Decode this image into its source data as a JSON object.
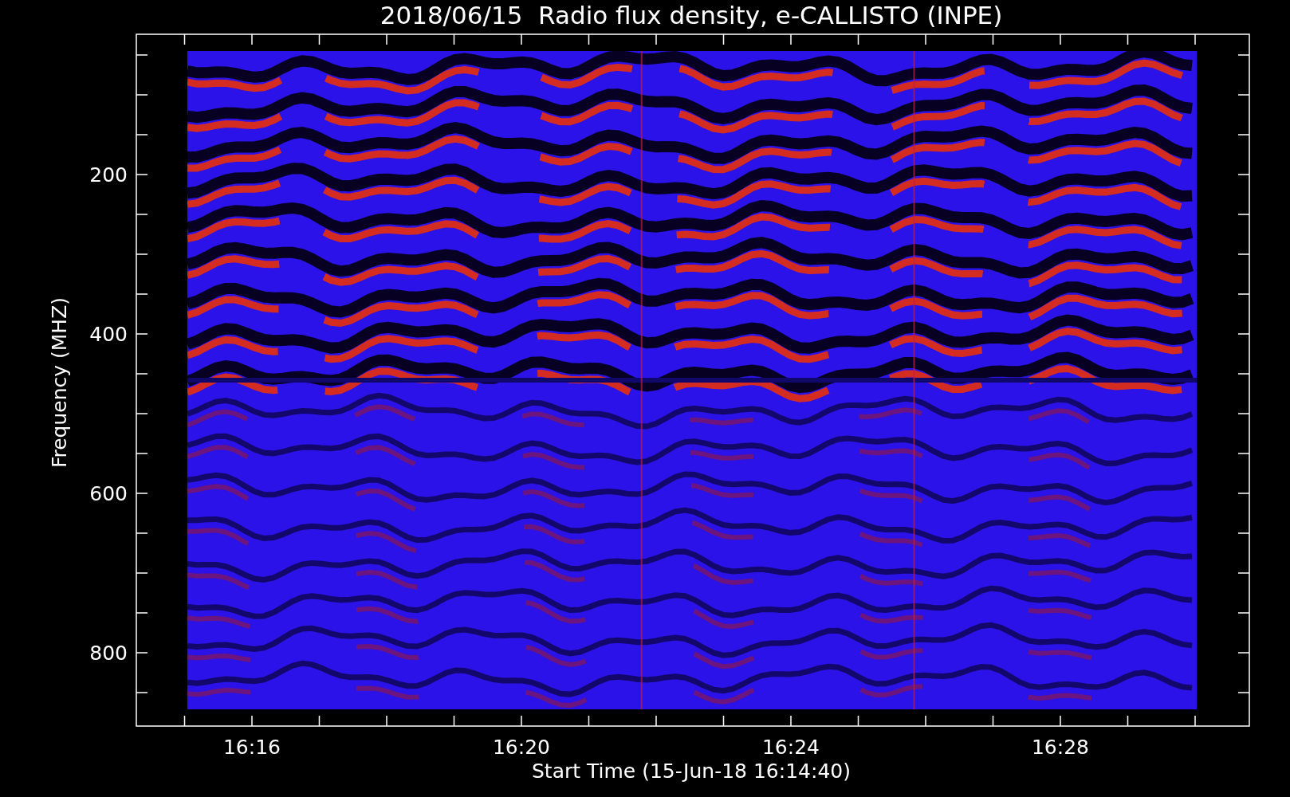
{
  "plot": {
    "title": "2018/06/15  Radio flux density, e-CALLISTO (INPE)",
    "xlabel": "Start Time (15-Jun-18 16:14:40)",
    "ylabel": "Frequency (MHZ)",
    "xticks": [
      {
        "label": "16:16"
      },
      {
        "label": "16:20"
      },
      {
        "label": "16:24"
      },
      {
        "label": "16:28"
      }
    ],
    "yticks": [
      {
        "label": "200"
      },
      {
        "label": "400"
      },
      {
        "label": "600"
      },
      {
        "label": "800"
      }
    ]
  }
}
